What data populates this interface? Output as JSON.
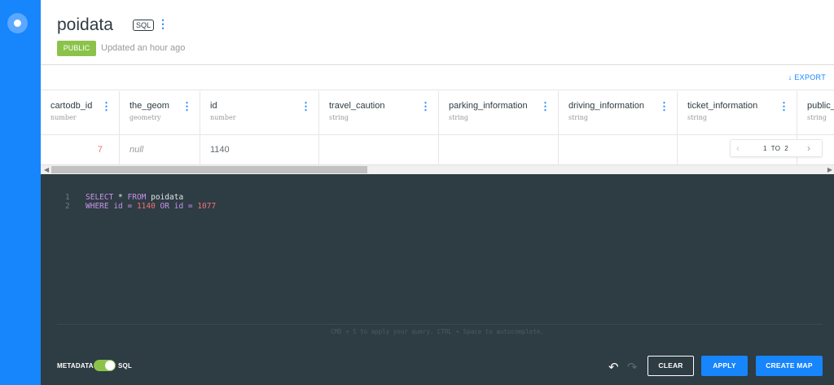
{
  "dataset": {
    "title": "poidata",
    "mode_tag": "SQL",
    "privacy": "PUBLIC",
    "updated": "Updated an hour ago"
  },
  "toolbar": {
    "export_label": "EXPORT"
  },
  "table": {
    "columns": [
      {
        "name": "cartodb_id",
        "type": "number"
      },
      {
        "name": "the_geom",
        "type": "geometry"
      },
      {
        "name": "id",
        "type": "number"
      },
      {
        "name": "travel_caution",
        "type": "string"
      },
      {
        "name": "parking_information",
        "type": "string"
      },
      {
        "name": "driving_information",
        "type": "string"
      },
      {
        "name": "ticket_information",
        "type": "string"
      },
      {
        "name": "public_",
        "type": "string"
      }
    ],
    "rows": [
      [
        "7",
        "null",
        "1140",
        "",
        "",
        "",
        "",
        ""
      ]
    ]
  },
  "pagination": {
    "current": "1",
    "separator": "TO",
    "total": "2"
  },
  "editor": {
    "lines": [
      {
        "n": "1",
        "tokens": [
          {
            "t": "SELECT * FROM ",
            "c": "kw-mix1"
          },
          {
            "t": "poidata",
            "c": "plain"
          }
        ]
      },
      {
        "n": "2",
        "tokens": [
          {
            "t": "WHERE id = ",
            "c": "kw-mix2"
          },
          {
            "t": "1140",
            "c": "num"
          },
          {
            "t": " OR id = ",
            "c": "kw-mix3"
          },
          {
            "t": "1077",
            "c": "num"
          }
        ]
      }
    ],
    "line1": {
      "n": "1",
      "kw1": "SELECT",
      "op": " * ",
      "kw2": "FROM",
      "sp": " ",
      "table": "poidata"
    },
    "line2": {
      "n": "2",
      "kw1": "WHERE",
      "col1": " id = ",
      "v1": "1140",
      "kw2": " OR",
      "col2": " id = ",
      "v2": "1077"
    },
    "hint": "CMD + S to apply your query. CTRL + Space to autocomplete."
  },
  "footer": {
    "metadata_label": "METADATA",
    "sql_label": "SQL",
    "sql_toggle_on": true,
    "clear_label": "CLEAR",
    "apply_label": "APPLY",
    "create_map_label": "CREATE MAP"
  },
  "colors": {
    "brand": "#1785fb",
    "editor_bg": "#2e3c43",
    "public_badge": "#8bc34a"
  }
}
